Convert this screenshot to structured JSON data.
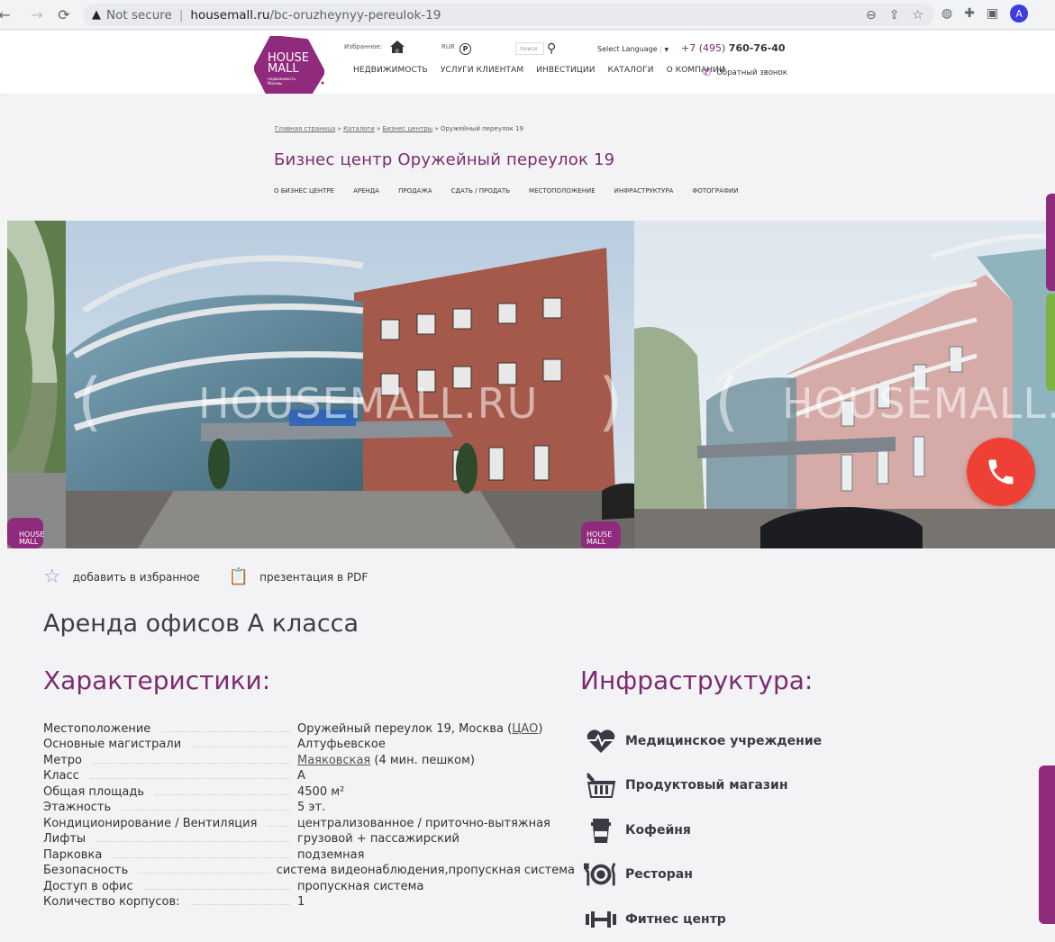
{
  "browser": {
    "not_secure": "Not secure",
    "separator": "|",
    "host": "housemall.ru",
    "path": "/bc-oruzheynyy-pereulok-19",
    "avatar_letter": "A"
  },
  "header": {
    "logo_line1": "HOUSE",
    "logo_line2": "MALL",
    "logo_small": "недвижимость Москвы",
    "favorites_label": "Избранное:",
    "favorites_count": "0",
    "currency_label": "RUR",
    "currency_symbol": "Р",
    "search_placeholder": "поиск",
    "language": "Select Language",
    "lang_arrow": "▼",
    "phone_prefix": "+7 (495)",
    "phone_number": "760-76-40",
    "callback": "Обратный звонок",
    "nav": [
      "НЕДВИЖИМОСТЬ",
      "УСЛУГИ КЛИЕНТАМ",
      "ИНВЕСТИЦИИ",
      "КАТАЛОГИ",
      "О КОМПАНИИ"
    ]
  },
  "breadcrumb": {
    "home": "Главная страница",
    "catalogs": "Каталоги",
    "business_centers": "Бизнес центры",
    "current": "Оружейный переулок 19",
    "sep": "»"
  },
  "page_title": "Бизнес центр Оружейный переулок 19",
  "sub_nav": [
    "О БИЗНЕС ЦЕНТРЕ",
    "АРЕНДА",
    "ПРОДАЖА",
    "СДАТЬ / ПРОДАТЬ",
    "МЕСТОПОЛОЖЕНИЕ",
    "ИНФРАСТРУКТУРА",
    "ФОТОГРАФИИ"
  ],
  "gallery": {
    "watermark": "HOUSEMALL.RU",
    "watermark_right": "HOUSEMALL.RU",
    "badge": "HOUSE MALL"
  },
  "actions": {
    "favorite": "добавить в избранное",
    "pdf": "презентация в PDF"
  },
  "rent_heading": "Аренда офисов А класса",
  "chars_heading": "Характеристики:",
  "infra_heading": "Инфраструктура:",
  "characteristics": [
    {
      "label": "Местоположение",
      "value": "Оружейный переулок 19, Москва (",
      "link": "ЦАО",
      "after": ")"
    },
    {
      "label": "Основные магистрали",
      "value": "Алтуфьевское",
      "link": "",
      "after": ""
    },
    {
      "label": "Метро",
      "value": "",
      "link": "Маяковская",
      "after": " (4 мин. пешком)"
    },
    {
      "label": "Класс",
      "value": "А",
      "link": "",
      "after": ""
    },
    {
      "label": "Общая площадь",
      "value": "4500 м²",
      "link": "",
      "after": ""
    },
    {
      "label": "Этажность",
      "value": "5 эт.",
      "link": "",
      "after": ""
    },
    {
      "label": "Кондиционирование / Вентиляция",
      "value": "централизованное / приточно-вытяжная",
      "link": "",
      "after": ""
    },
    {
      "label": "Лифты",
      "value": "грузовой + пассажирский",
      "link": "",
      "after": ""
    },
    {
      "label": "Парковка",
      "value": "подземная",
      "link": "",
      "after": ""
    },
    {
      "label": "Безопасность",
      "value": "система видеонаблюдения,пропускная система",
      "link": "",
      "after": ""
    },
    {
      "label": "Доступ в офис",
      "value": "пропускная система",
      "link": "",
      "after": ""
    },
    {
      "label": "Количество корпусов:",
      "value": "1",
      "link": "",
      "after": ""
    }
  ],
  "infrastructure": [
    {
      "label": "Медицинское учреждение",
      "icon": "heart-pulse-icon"
    },
    {
      "label": "Продуктовый магазин",
      "icon": "shopping-basket-icon"
    },
    {
      "label": "Кофейня",
      "icon": "coffee-cup-icon"
    },
    {
      "label": "Ресторан",
      "icon": "plate-fork-knife-icon"
    },
    {
      "label": "Фитнес центр",
      "icon": "dumbbell-icon"
    }
  ],
  "colors": {
    "brand": "#7b2b71",
    "call_button": "#ef4036",
    "accent_star": "#b58ad0"
  }
}
